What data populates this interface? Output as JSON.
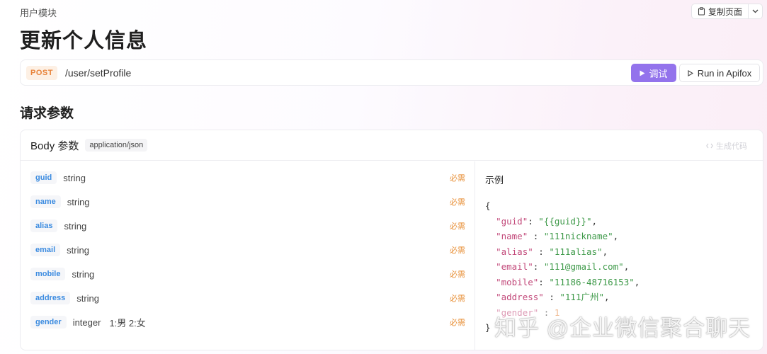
{
  "breadcrumb": "用户模块",
  "copy_page_label": "复制页面",
  "title": "更新个人信息",
  "endpoint": {
    "method": "POST",
    "path": "/user/setProfile",
    "debug_label": "调试",
    "run_label": "Run in Apifox"
  },
  "section_title": "请求参数",
  "body": {
    "title": "Body 参数",
    "content_type": "application/json",
    "gen_code_label": "生成代码",
    "params": [
      {
        "name": "guid",
        "type": "string",
        "desc": "",
        "required": "必需"
      },
      {
        "name": "name",
        "type": "string",
        "desc": "",
        "required": "必需"
      },
      {
        "name": "alias",
        "type": "string",
        "desc": "",
        "required": "必需"
      },
      {
        "name": "email",
        "type": "string",
        "desc": "",
        "required": "必需"
      },
      {
        "name": "mobile",
        "type": "string",
        "desc": "",
        "required": "必需"
      },
      {
        "name": "address",
        "type": "string",
        "desc": "",
        "required": "必需"
      },
      {
        "name": "gender",
        "type": "integer",
        "desc": "1:男 2:女",
        "required": "必需"
      }
    ]
  },
  "example": {
    "title": "示例",
    "open": "{",
    "close": "}",
    "lines": [
      {
        "key": "\"guid\"",
        "sep": ": ",
        "value": "\"{{guid}}\"",
        "end": ","
      },
      {
        "key": "\"name\"",
        "sep": " : ",
        "value": "\"111nickname\"",
        "end": ","
      },
      {
        "key": "\"alias\"",
        "sep": " : ",
        "value": "\"111alias\"",
        "end": ","
      },
      {
        "key": "\"email\"",
        "sep": ": ",
        "value": "\"111@gmail.com\"",
        "end": ","
      },
      {
        "key": "\"mobile\"",
        "sep": ": ",
        "value": "\"11186-48716153\"",
        "end": ","
      },
      {
        "key": "\"address\"",
        "sep": " : ",
        "value": "\"111广州\"",
        "end": ","
      },
      {
        "key": "\"gender\"",
        "sep": " : ",
        "value": "1",
        "end": ""
      }
    ]
  },
  "watermark": "知乎 @企业微信聚合聊天",
  "colors": {
    "accent": "#9373ec",
    "post_method": "#e8833a",
    "param_name": "#3b8be0",
    "required": "#e8913a",
    "json_key": "#c2497a",
    "json_string": "#3f9a4a",
    "json_number": "#e3823a"
  }
}
